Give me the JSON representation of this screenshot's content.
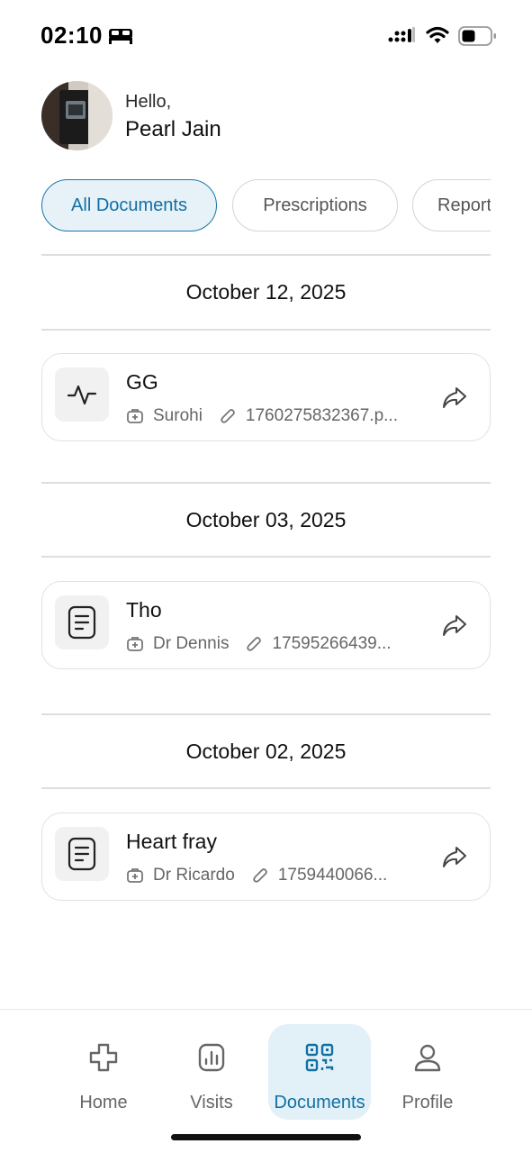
{
  "status_bar": {
    "time": "02:10"
  },
  "header": {
    "greeting": "Hello,",
    "user_name": "Pearl Jain"
  },
  "tabs": [
    {
      "label": "All Documents",
      "active": true
    },
    {
      "label": "Prescriptions",
      "active": false
    },
    {
      "label": "Reports",
      "active": false
    }
  ],
  "groups": [
    {
      "date": "October 12, 2025",
      "document": {
        "title": "GG",
        "icon": "activity-icon",
        "doctor": "Surohi",
        "file": "1760275832367.p..."
      }
    },
    {
      "date": "October 03, 2025",
      "document": {
        "title": "Tho",
        "icon": "document-icon",
        "doctor": "Dr Dennis",
        "file": "17595266439..."
      }
    },
    {
      "date": "October 02, 2025",
      "document": {
        "title": "Heart fray",
        "icon": "document-icon",
        "doctor": "Dr Ricardo",
        "file": "1759440066..."
      }
    }
  ],
  "bottom_nav": [
    {
      "label": "Home",
      "icon": "medical-cross-icon",
      "active": false
    },
    {
      "label": "Visits",
      "icon": "chart-report-icon",
      "active": false
    },
    {
      "label": "Documents",
      "icon": "qr-code-icon",
      "active": true
    },
    {
      "label": "Profile",
      "icon": "user-icon",
      "active": false
    }
  ],
  "colors": {
    "accent": "#1270a3",
    "accent_bg": "#e6f1f8",
    "border": "#dedede",
    "muted_text": "#666666"
  }
}
